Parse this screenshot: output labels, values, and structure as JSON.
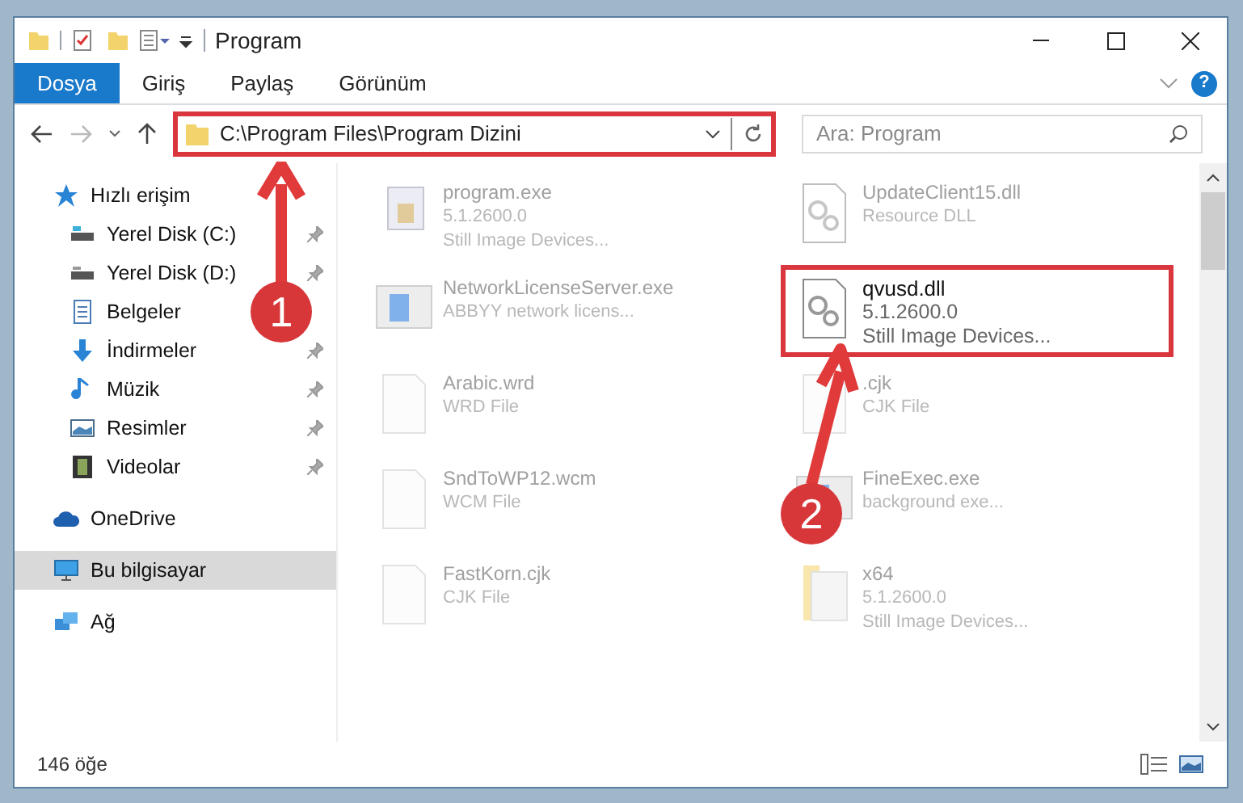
{
  "window": {
    "title": "Program"
  },
  "ribbon_tabs": [
    {
      "label": "Dosya",
      "selected": true
    },
    {
      "label": "Giriş",
      "selected": false
    },
    {
      "label": "Paylaş",
      "selected": false
    },
    {
      "label": "Görünüm",
      "selected": false
    }
  ],
  "help": "?",
  "address": {
    "path": "C:\\Program Files\\Program Dizini",
    "highlighted": true
  },
  "search": {
    "placeholder": "Ara: Program"
  },
  "sidebar": {
    "items": [
      {
        "label": "Hızlı erişim",
        "selected": false,
        "children": [
          {
            "label": "Yerel Disk (C:)",
            "pinned": true,
            "selected": false
          },
          {
            "label": "Yerel Disk (D:)",
            "pinned": true,
            "selected": false
          },
          {
            "label": "Belgeler",
            "selected": false
          },
          {
            "label": "İndirmeler",
            "pinned": true,
            "selected": false
          },
          {
            "label": "Müzik",
            "pinned": true,
            "selected": false
          },
          {
            "label": "Resimler",
            "pinned": true,
            "selected": false
          },
          {
            "label": "Videolar",
            "pinned": true,
            "selected": false
          }
        ]
      },
      {
        "label": "OneDrive",
        "selected": false
      },
      {
        "label": "Bu bilgisayar",
        "selected": true
      },
      {
        "label": "Ağ",
        "selected": false
      }
    ]
  },
  "files": [
    {
      "name": "program.exe",
      "lines": [
        "5.1.2600.0",
        "Still Image Devices..."
      ],
      "blurred": true,
      "highlighted": false
    },
    {
      "name": "UpdateClient15.dll",
      "lines": [
        "Resource DLL"
      ],
      "blurred": true,
      "highlighted": false
    },
    {
      "name": "NetworkLicenseServer.exe",
      "lines": [
        "ABBYY network licens..."
      ],
      "blurred": true,
      "highlighted": false
    },
    {
      "name": "qvusd.dll",
      "lines": [
        "5.1.2600.0",
        "Still Image Devices..."
      ],
      "blurred": false,
      "highlighted": true
    },
    {
      "name": "Arabic.wrd",
      "lines": [
        "WRD File"
      ],
      "blurred": true,
      "highlighted": false
    },
    {
      "name": ".cjk",
      "lines": [
        "CJK File"
      ],
      "blurred": true,
      "highlighted": false
    },
    {
      "name": "SndToWP12.wcm",
      "lines": [
        "WCM File"
      ],
      "blurred": true,
      "highlighted": false
    },
    {
      "name": "FineExec.exe",
      "lines": [
        "background exe..."
      ],
      "blurred": true,
      "highlighted": false
    },
    {
      "name": "FastKorn.cjk",
      "lines": [
        "CJK File"
      ],
      "blurred": true,
      "highlighted": false
    },
    {
      "name": "x64",
      "lines": [
        "5.1.2600.0",
        "Still Image Devices..."
      ],
      "blurred": true,
      "highlighted": false
    }
  ],
  "status_bar": {
    "count": "146 öğe"
  },
  "annotations": [
    {
      "number": "1"
    },
    {
      "number": "2"
    }
  ]
}
